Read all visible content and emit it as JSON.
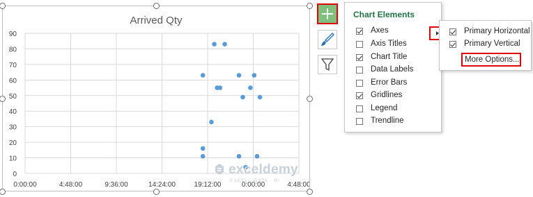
{
  "chart": {
    "title": "Arrived Qty",
    "y_ticks": [
      "0",
      "10",
      "20",
      "30",
      "40",
      "50",
      "60",
      "70",
      "80",
      "90"
    ],
    "x_ticks": [
      "0:00:00",
      "4:48:00",
      "9:36:00",
      "14:24:00",
      "19:12:00",
      "0:00:00",
      "4:48:00"
    ],
    "marker_color": "#5b9bd5"
  },
  "chart_data": {
    "type": "scatter",
    "title": "Arrived Qty",
    "xlabel": "",
    "ylabel": "",
    "x_tick_labels": [
      "0:00:00",
      "4:48:00",
      "9:36:00",
      "14:24:00",
      "19:12:00",
      "0:00:00",
      "4:48:00"
    ],
    "x_unit": "hours",
    "xlim": [
      0,
      28.8
    ],
    "ylim": [
      0,
      90
    ],
    "grid": true,
    "legend": "none",
    "series": [
      {
        "points": [
          {
            "x": 18.7,
            "y": 63
          },
          {
            "x": 18.7,
            "y": 16
          },
          {
            "x": 18.7,
            "y": 11
          },
          {
            "x": 19.6,
            "y": 33
          },
          {
            "x": 19.9,
            "y": 83
          },
          {
            "x": 20.2,
            "y": 55
          },
          {
            "x": 20.5,
            "y": 55
          },
          {
            "x": 21.0,
            "y": 83
          },
          {
            "x": 22.5,
            "y": 63
          },
          {
            "x": 22.5,
            "y": 11
          },
          {
            "x": 22.9,
            "y": 49
          },
          {
            "x": 23.2,
            "y": 4
          },
          {
            "x": 23.7,
            "y": 55
          },
          {
            "x": 24.1,
            "y": 63
          },
          {
            "x": 24.4,
            "y": 11
          },
          {
            "x": 24.7,
            "y": 49
          }
        ]
      }
    ]
  },
  "chart_elements_panel": {
    "title": "Chart Elements",
    "items": [
      {
        "label": "Axes",
        "checked": true
      },
      {
        "label": "Axis Titles",
        "checked": false
      },
      {
        "label": "Chart Title",
        "checked": true
      },
      {
        "label": "Data Labels",
        "checked": false
      },
      {
        "label": "Error Bars",
        "checked": false
      },
      {
        "label": "Gridlines",
        "checked": true
      },
      {
        "label": "Legend",
        "checked": false
      },
      {
        "label": "Trendline",
        "checked": false
      }
    ]
  },
  "axes_submenu": {
    "items": [
      {
        "label": "Primary Horizontal",
        "checked": true
      },
      {
        "label": "Primary Vertical",
        "checked": true
      }
    ],
    "more_options": "More Options..."
  },
  "side_buttons": {
    "chart_elements_icon": "plus-icon",
    "chart_styles_icon": "paintbrush-icon",
    "chart_filters_icon": "funnel-icon"
  },
  "watermark": {
    "name": "exceldemy",
    "tagline": "EXCEL · DATA · BI"
  }
}
